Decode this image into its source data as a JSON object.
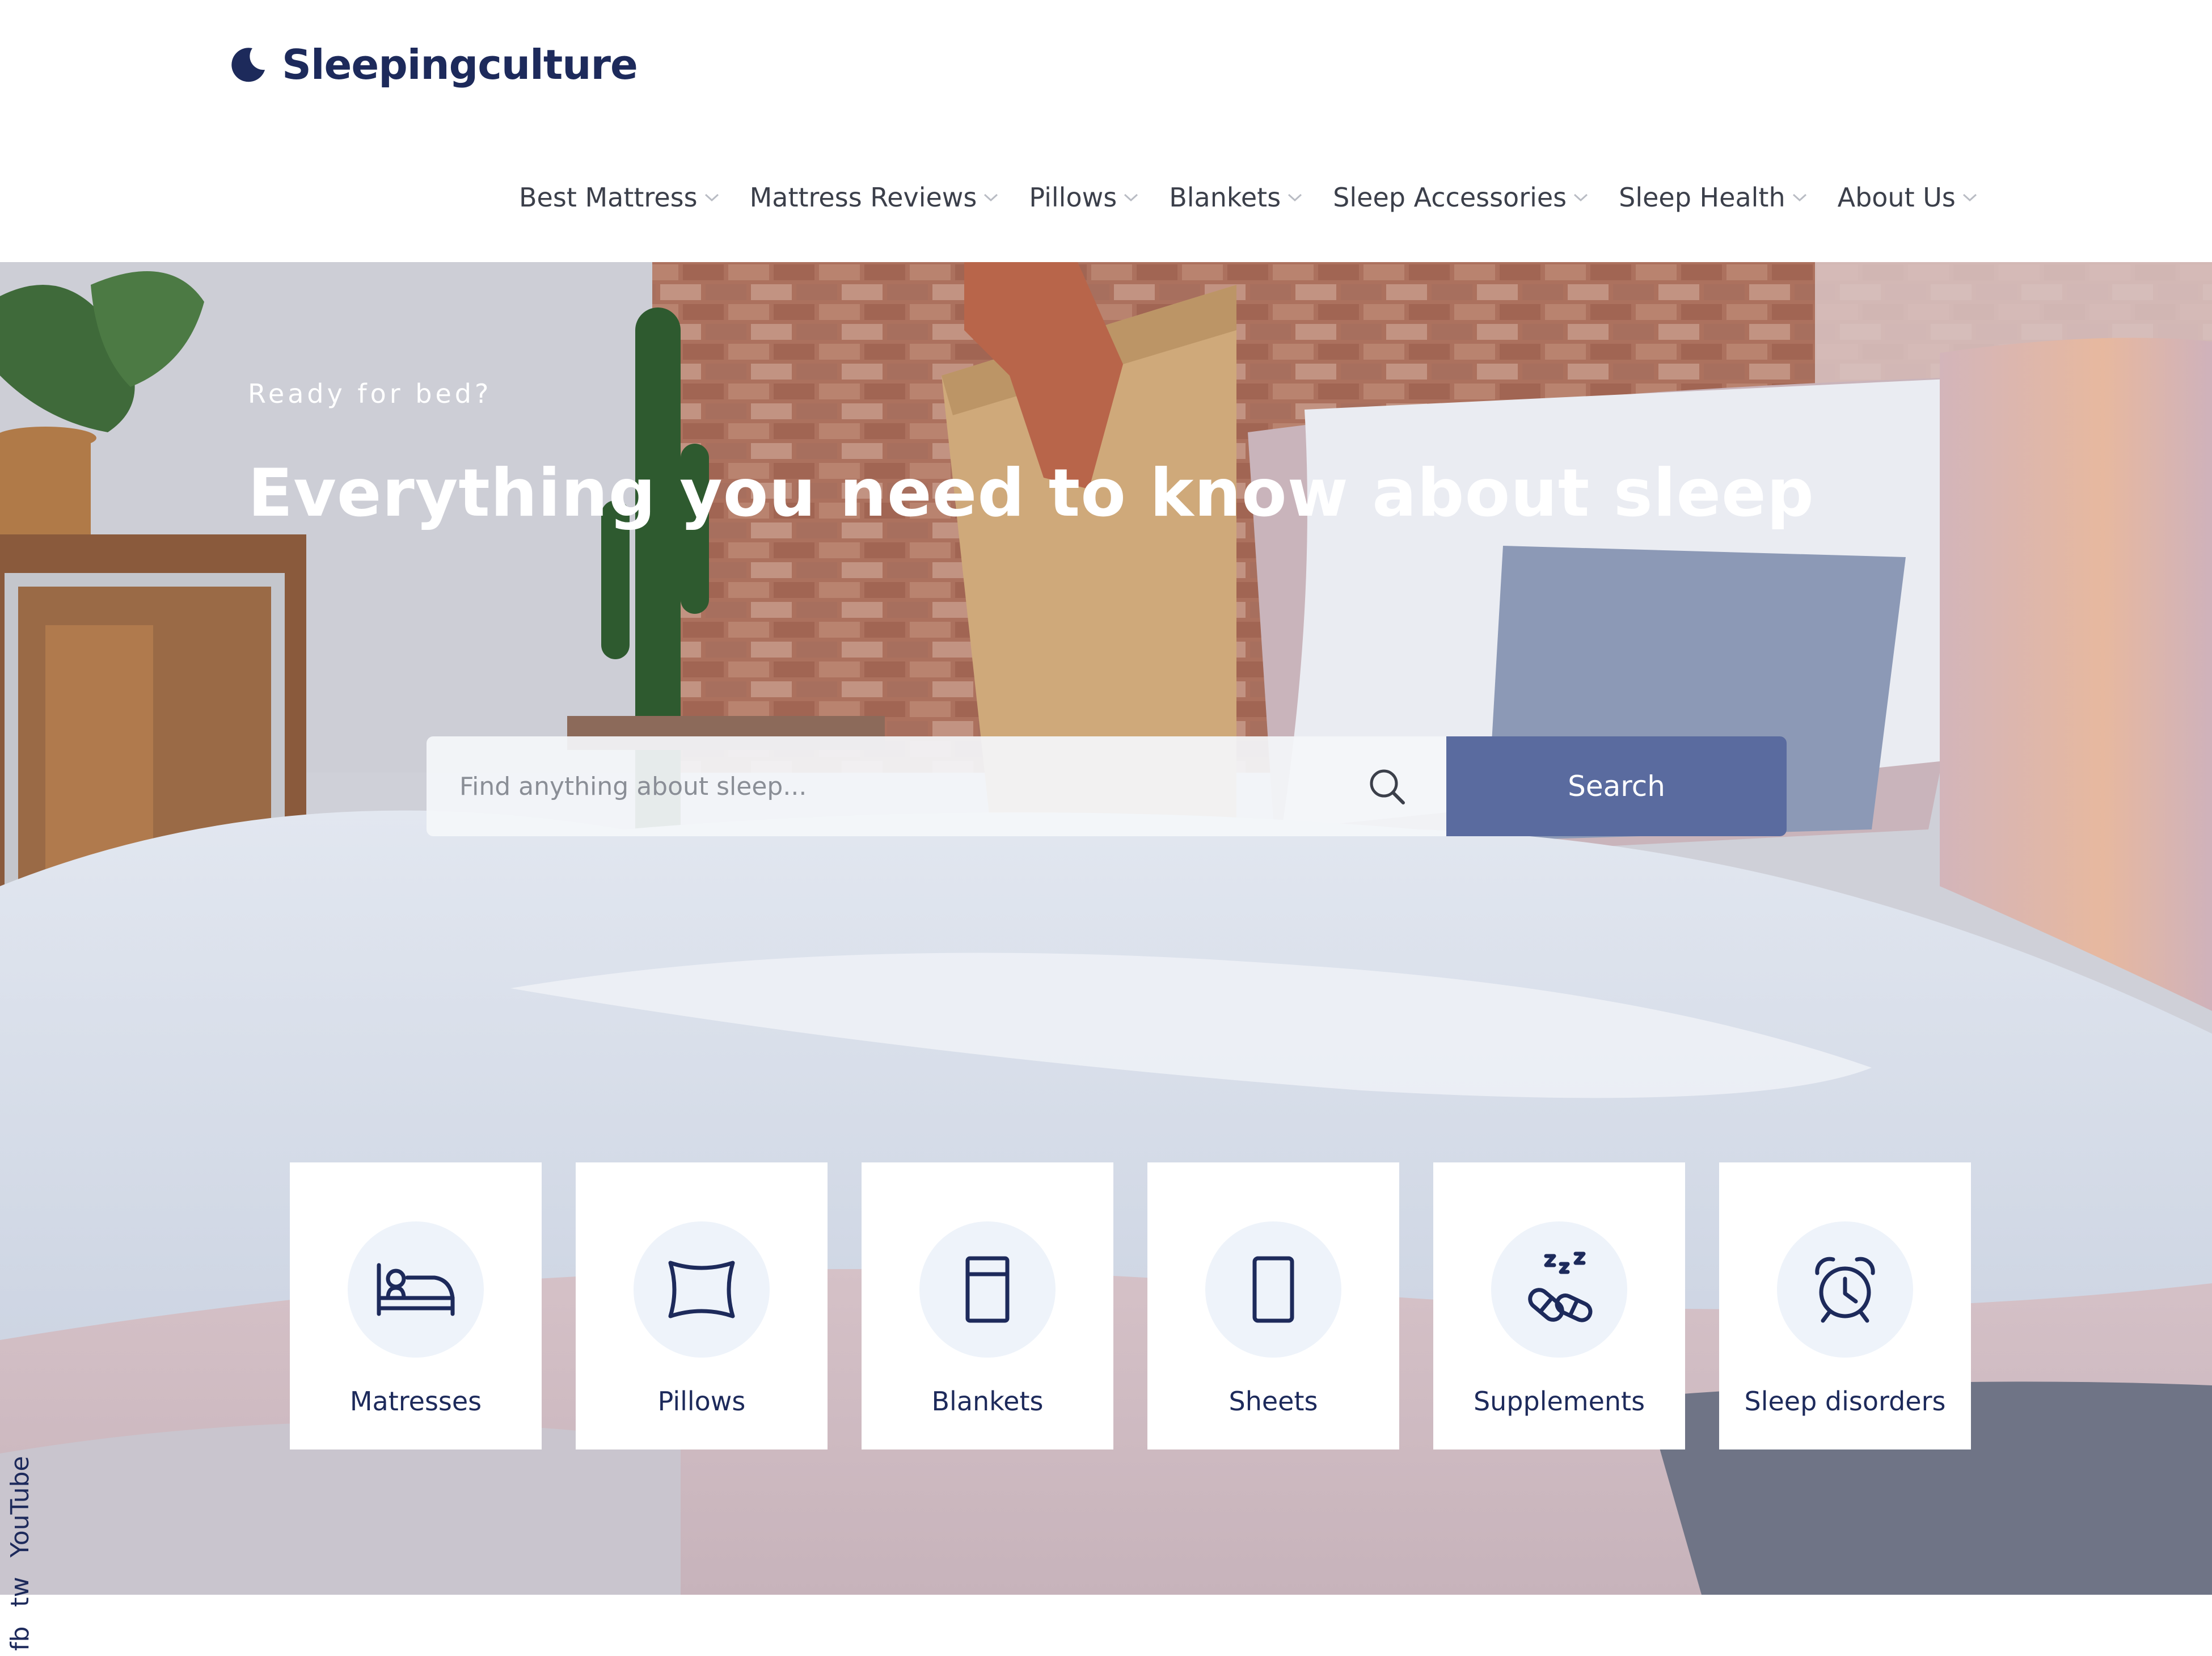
{
  "brand": {
    "name": "Sleepingculture"
  },
  "nav": {
    "items": [
      {
        "label": "Best Mattress"
      },
      {
        "label": "Mattress Reviews"
      },
      {
        "label": "Pillows"
      },
      {
        "label": "Blankets"
      },
      {
        "label": "Sleep Accessories"
      },
      {
        "label": "Sleep Health"
      },
      {
        "label": "About Us"
      }
    ]
  },
  "hero": {
    "eyebrow": "Ready for bed?",
    "title": "Everything you need to know about sleep",
    "search": {
      "placeholder": "Find anything about sleep...",
      "button_label": "Search"
    }
  },
  "categories": [
    {
      "label": "Matresses",
      "icon": "bed-icon"
    },
    {
      "label": "Pillows",
      "icon": "pillow-icon"
    },
    {
      "label": "Blankets",
      "icon": "blanket-icon"
    },
    {
      "label": "Sheets",
      "icon": "sheet-icon"
    },
    {
      "label": "Supplements",
      "icon": "pills-icon"
    },
    {
      "label": "Sleep disorders",
      "icon": "alarm-clock-icon"
    }
  ],
  "social": {
    "links": [
      "fb",
      "tw",
      "YouTube"
    ]
  },
  "colors": {
    "brand_navy": "#1d2a5b",
    "search_button": "#5a6b9f",
    "icon_circle": "#eef3fa",
    "nav_text": "#3b3f4a"
  }
}
